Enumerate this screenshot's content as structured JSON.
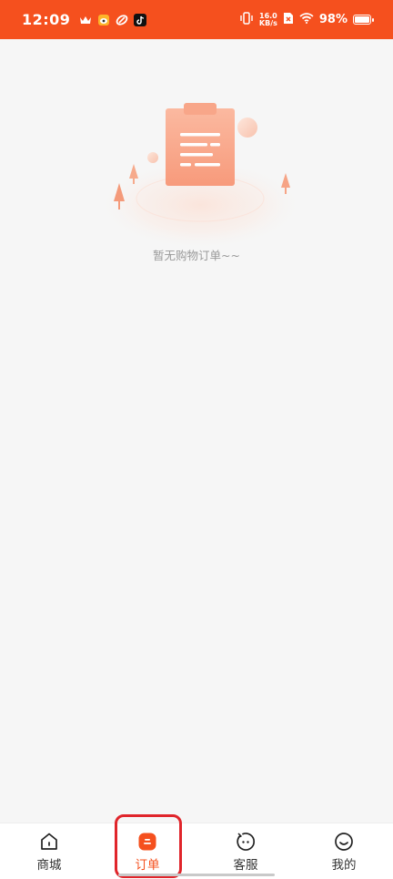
{
  "status_bar": {
    "time": "12:09",
    "net_speed_value": "16.0",
    "net_speed_unit": "KB/s",
    "battery_text": "98%",
    "background_color": "#f5501e",
    "left_icons": [
      "crown-icon",
      "weibo-icon",
      "link-icon",
      "tiktok-icon"
    ],
    "right_icons": [
      "vibrate-icon",
      "no-sim-icon",
      "wifi-icon",
      "battery-icon"
    ]
  },
  "empty_state": {
    "message": "暂无购物订单~~",
    "illustration": "clipboard-illustration"
  },
  "tab_bar": {
    "accent_color": "#f5501e",
    "items": [
      {
        "label": "商城",
        "icon": "home-icon",
        "active": false
      },
      {
        "label": "订单",
        "icon": "order-icon",
        "active": true
      },
      {
        "label": "客服",
        "icon": "service-icon",
        "active": false
      },
      {
        "label": "我的",
        "icon": "profile-icon",
        "active": false
      }
    ]
  }
}
